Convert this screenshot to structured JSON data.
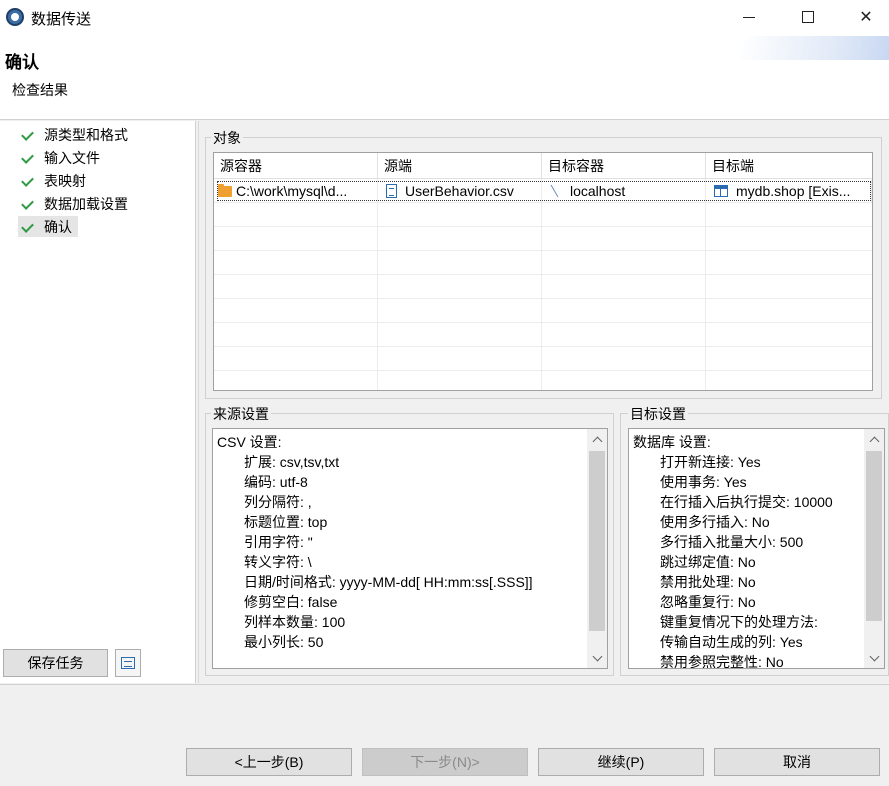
{
  "window": {
    "title": "数据传送",
    "minimize_icon": "minimize-icon",
    "maximize_icon": "maximize-icon",
    "close_symbol": "✕"
  },
  "header": {
    "title": "确认",
    "subtitle": "检查结果"
  },
  "nav": {
    "items": [
      {
        "label": "源类型和格式",
        "checked": true,
        "selected": false
      },
      {
        "label": "输入文件",
        "checked": true,
        "selected": false
      },
      {
        "label": "表映射",
        "checked": true,
        "selected": false
      },
      {
        "label": "数据加载设置",
        "checked": true,
        "selected": false
      },
      {
        "label": "确认",
        "checked": true,
        "selected": true
      }
    ],
    "save_task_label": "保存任务"
  },
  "objects": {
    "group_label": "对象",
    "columns": [
      "源容器",
      "源端",
      "目标容器",
      "目标端"
    ],
    "rows": [
      {
        "source_container": "C:\\work\\mysql\\d...",
        "source": "UserBehavior.csv",
        "target_container": "localhost",
        "target": "mydb.shop [Exis..."
      }
    ]
  },
  "source_settings": {
    "group_label": "来源设置",
    "heading": "CSV 设置:",
    "lines": [
      "扩展: csv,tsv,txt",
      "编码: utf-8",
      "列分隔符: ,",
      "标题位置: top",
      "引用字符: \"",
      "转义字符: \\",
      "日期/时间格式: yyyy-MM-dd[ HH:mm:ss[.SSS]]",
      "修剪空白: false",
      "列样本数量: 100",
      "最小列长: 50"
    ]
  },
  "target_settings": {
    "group_label": "目标设置",
    "heading": "数据库 设置:",
    "lines": [
      "打开新连接: Yes",
      "使用事务: Yes",
      "在行插入后执行提交: 10000",
      "使用多行插入: No",
      "多行插入批量大小: 500",
      "跳过绑定值: No",
      "禁用批处理: No",
      "忽略重复行: No",
      "键重复情况下的处理方法:",
      "传输自动生成的列: Yes",
      "禁用参照完整性: No"
    ]
  },
  "footer": {
    "back_label": "<上一步(B)",
    "next_label": "下一步(N)>",
    "continue_label": "继续(P)",
    "cancel_label": "取消"
  },
  "colors": {
    "check": "#2e9b44",
    "folder": "#f0a030",
    "accent_blue": "#2b6cb0"
  }
}
